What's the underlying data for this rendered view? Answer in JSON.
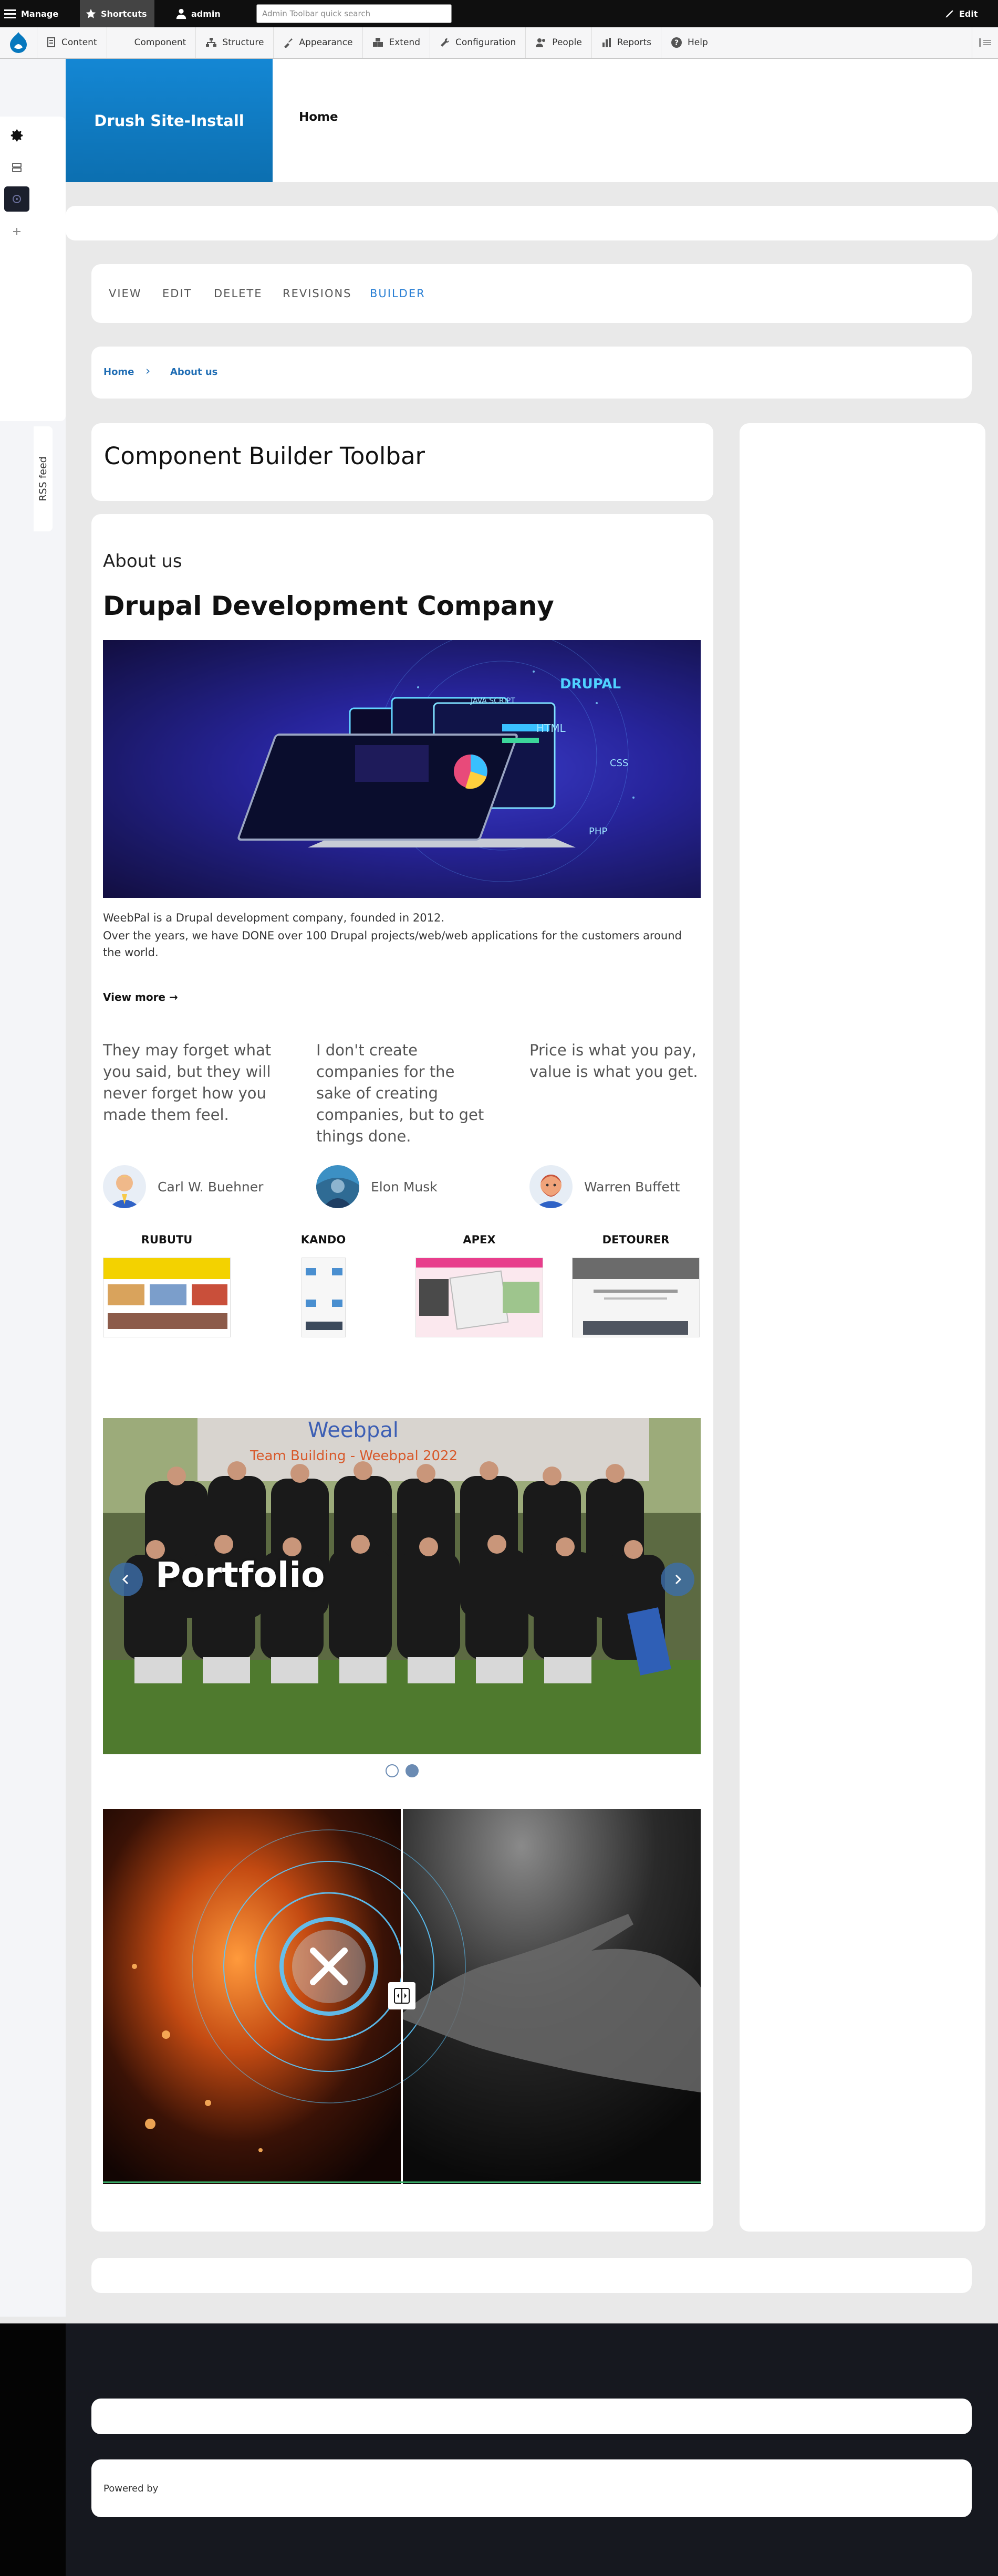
{
  "toolbar": {
    "manage_label": "Manage",
    "shortcuts_label": "Shortcuts",
    "user_label": "admin",
    "search_placeholder": "Admin Toolbar quick search",
    "edit_label": "Edit"
  },
  "admin_menu": {
    "items": [
      {
        "label": "Content",
        "icon": "content-icon"
      },
      {
        "label": "Component",
        "icon": ""
      },
      {
        "label": "Structure",
        "icon": "structure-icon"
      },
      {
        "label": "Appearance",
        "icon": "appearance-icon"
      },
      {
        "label": "Extend",
        "icon": "extend-icon"
      },
      {
        "label": "Configuration",
        "icon": "wrench-icon"
      },
      {
        "label": "People",
        "icon": "people-icon"
      },
      {
        "label": "Reports",
        "icon": "reports-icon"
      },
      {
        "label": "Help",
        "icon": "help-icon"
      }
    ]
  },
  "sidebar": {
    "rss_label": "RSS feed"
  },
  "header": {
    "site_name": "Drush Site-Install",
    "nav_home": "Home"
  },
  "tabs": [
    "VIEW",
    "EDIT",
    "DELETE",
    "REVISIONS",
    "BUILDER"
  ],
  "active_tab": "BUILDER",
  "breadcrumb": {
    "home": "Home",
    "separator": "›",
    "current": "About us"
  },
  "page_title": "Component Builder Toolbar",
  "content": {
    "section_label": "About us",
    "heading": "Drupal Development Company",
    "hero_labels": {
      "drupal": "DRUPAL",
      "javascript": "JAVA SCRIPT",
      "html": "HTML",
      "css": "CSS",
      "php": "PHP"
    },
    "description_line1": "WeebPal is a Drupal development company, founded in 2012.",
    "description_line2": "Over the years, we have DONE over 100 Drupal projects/web/web applications for the customers around the world.",
    "view_more": "View more →",
    "quotes": [
      {
        "text": "They may forget what you said, but they will never forget how you made them feel.",
        "author": "Carl W. Buehner"
      },
      {
        "text": "I don't create companies for the sake of creating companies, but to get things done.",
        "author": "Elon Musk"
      },
      {
        "text": "Price is what you pay, value is what you get.",
        "author": "Warren Buffett"
      }
    ],
    "projects": [
      "RUBUTU",
      "KANDO",
      "APEX",
      "DETOURER"
    ],
    "slider": {
      "title": "Portfolio",
      "banner_brand": "Weebpal",
      "banner_text": "Team Building - Weebpal 2022",
      "slide_count": 2,
      "active_slide": 2
    }
  },
  "footer": {
    "powered_label": "Powered by"
  },
  "colors": {
    "brand_blue": "#1487d4",
    "link_blue": "#1f6db4",
    "toolbar_black": "#0f0f0f",
    "footer_dark": "#16181f"
  }
}
